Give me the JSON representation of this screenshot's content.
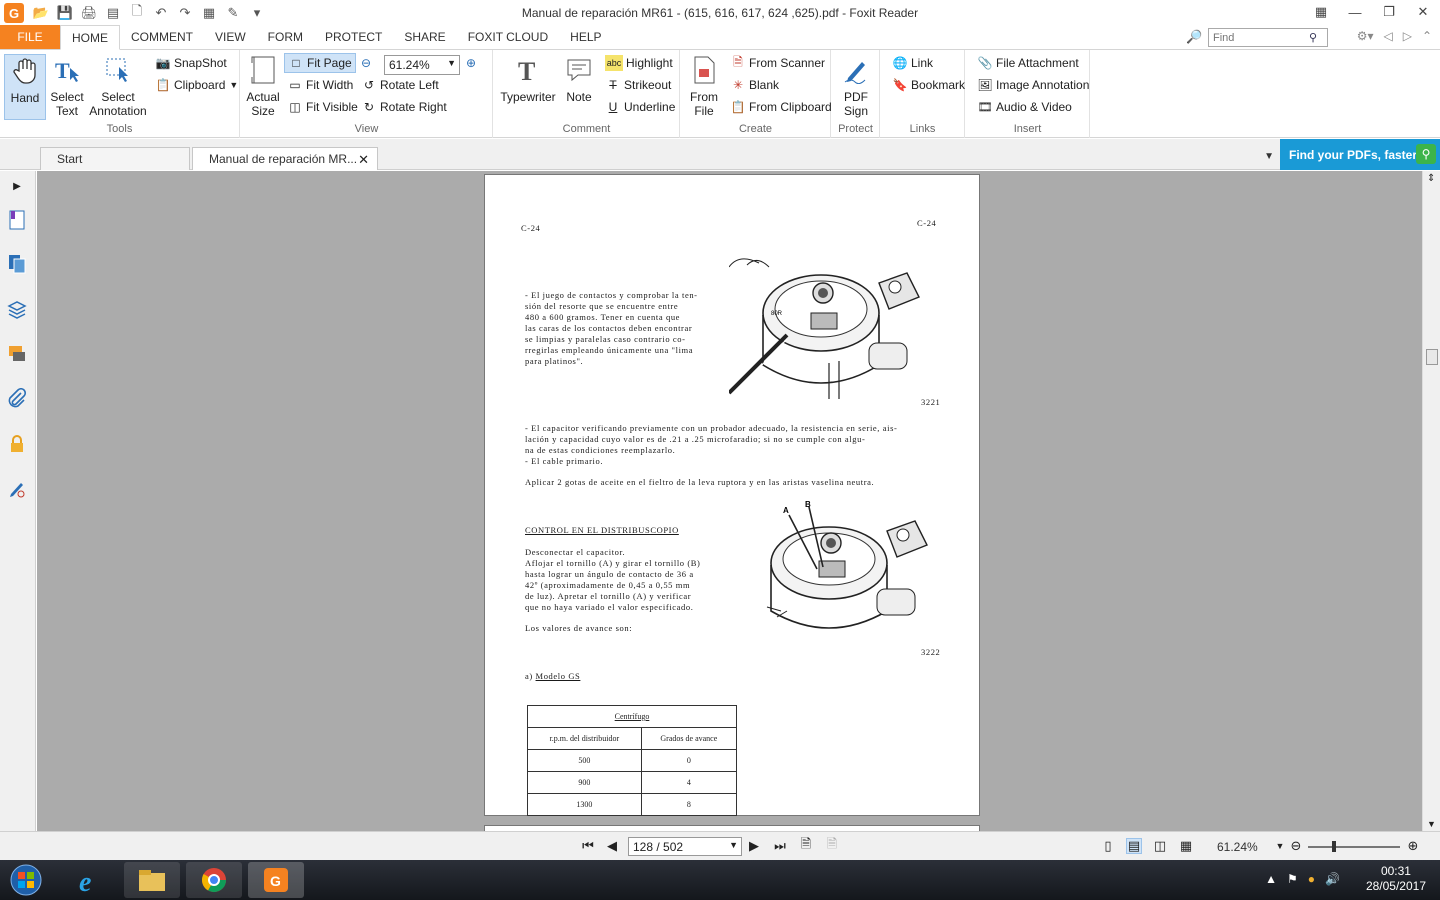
{
  "window": {
    "title": "Manual de reparación MR61 - (615, 616, 617, 624 ,625).pdf - Foxit Reader",
    "app_logo": "G"
  },
  "menu": {
    "file": "FILE",
    "tabs": [
      "HOME",
      "COMMENT",
      "VIEW",
      "FORM",
      "PROTECT",
      "SHARE",
      "FOXIT CLOUD",
      "HELP"
    ],
    "find_placeholder": "Find"
  },
  "ribbon": {
    "tools": {
      "label": "Tools",
      "hand": "Hand",
      "select_text_1": "Select",
      "select_text_2": "Text",
      "select_ann_1": "Select",
      "select_ann_2": "Annotation",
      "snapshot": "SnapShot",
      "clipboard": "Clipboard"
    },
    "view": {
      "label": "View",
      "actual_1": "Actual",
      "actual_2": "Size",
      "fit_page": "Fit Page",
      "fit_width": "Fit Width",
      "fit_visible": "Fit Visible",
      "zoom_value": "61.24%",
      "rotate_left": "Rotate Left",
      "rotate_right": "Rotate Right"
    },
    "comment": {
      "label": "Comment",
      "typewriter": "Typewriter",
      "note": "Note",
      "highlight": "Highlight",
      "strikeout": "Strikeout",
      "underline": "Underline"
    },
    "create": {
      "label": "Create",
      "from_file_1": "From",
      "from_file_2": "File",
      "from_scanner": "From Scanner",
      "blank": "Blank",
      "from_clipboard": "From Clipboard"
    },
    "protect": {
      "label": "Protect",
      "pdf_sign_1": "PDF",
      "pdf_sign_2": "Sign"
    },
    "links": {
      "label": "Links",
      "link": "Link",
      "bookmark": "Bookmark"
    },
    "insert": {
      "label": "Insert",
      "file_attachment": "File Attachment",
      "image_annotation": "Image Annotation",
      "audio_video": "Audio & Video"
    }
  },
  "tabs": {
    "start": "Start",
    "document": "Manual de reparación MR...",
    "find_pdfs": "Find your PDFs, faster!"
  },
  "page": {
    "header_left": "C-24",
    "header_right": "C-24",
    "para1": "- El juego de contactos y comprobar la ten-\nsión del resorte que se encuentre entre\n480 a 600 gramos. Tener en cuenta que\nlas caras de los contactos deben encontrar\nse limpias y paralelas caso contrario co-\nrregirlas empleando únicamente una \"lima\npara platinos\".",
    "fig1_number": "3221",
    "fig1_label": "80R",
    "para2": "- El capacitor verificando previamente con un probador adecuado, la resistencia en serie, ais-\nlación y capacidad cuyo valor es de .21 a .25 microfaradio; si no se cumple con algu-\nna de estas condiciones reemplazarlo.\n- El cable primario.",
    "para3": "Aplicar 2 gotas de aceite en el fieltro de la leva ruptora y en las aristas vaselina neutra.",
    "section_title": "CONTROL EN EL DISTRIBUSCOPIO",
    "para4": "Desconectar el capacitor.\nAflojar el tornillo (A) y girar el tornillo (B)\nhasta lograr un ángulo de contacto de 36 a\n42º (aproximadamente de 0,45 a 0,55 mm\nde luz). Apretar el tornillo (A) y verificar\nque no haya variado el valor especificado.",
    "para5": "Los valores de avance son:",
    "fig2_number": "3222",
    "fig2_label_a": "A",
    "fig2_label_b": "B",
    "model_prefix": "a)",
    "model_label": "Modelo GS",
    "table": {
      "caption": "Centrífugo",
      "headers": [
        "r.p.m. del distribuidor",
        "Grados de avance"
      ],
      "rows": [
        [
          "500",
          "0"
        ],
        [
          "900",
          "4"
        ],
        [
          "1300",
          "8"
        ]
      ]
    }
  },
  "status": {
    "page_indicator": "128 / 502",
    "zoom": "61.24%"
  },
  "taskbar": {
    "time": "00:31",
    "date": "28/05/2017"
  },
  "colors": {
    "accent": "#f58220",
    "findpdf_bg": "#1a9ad6",
    "viewer_bg": "#ababab"
  }
}
